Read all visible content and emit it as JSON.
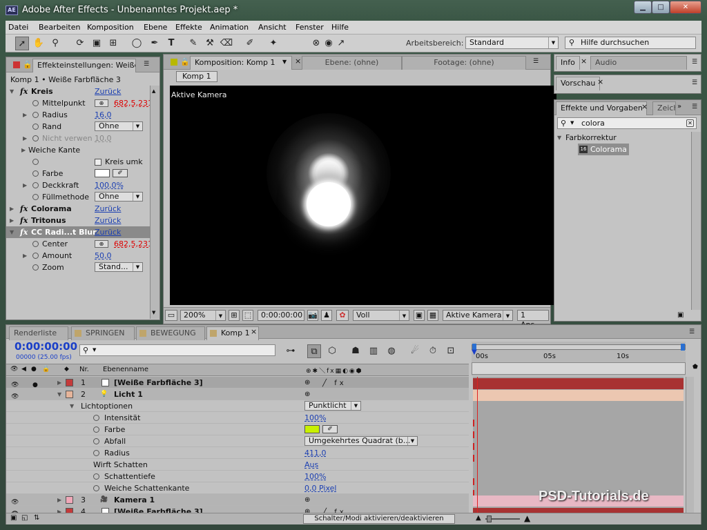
{
  "window": {
    "title": "Adobe After Effects - Unbenanntes Projekt.aep *",
    "app_badge": "AE"
  },
  "menu": [
    "Datei",
    "Bearbeiten",
    "Komposition",
    "Ebene",
    "Effekte",
    "Animation",
    "Ansicht",
    "Fenster",
    "Hilfe"
  ],
  "toolbar": {
    "workspace_label": "Arbeitsbereich:",
    "workspace_value": "Standard",
    "help_placeholder": "Hilfe durchsuchen"
  },
  "effects_panel": {
    "tab": "Effekteinstellungen: Weiße",
    "breadcrumb": "Komp 1 • Weiße Farbfläche 3",
    "rows": [
      {
        "type": "fx",
        "name": "Kreis",
        "reset": "Zurück"
      },
      {
        "type": "prop",
        "name": "Mittelpunkt",
        "value": "682,5,231",
        "color": "red",
        "crosshair": true
      },
      {
        "type": "prop",
        "name": "Radius",
        "value": "16,0",
        "color": "blue",
        "twirl": true
      },
      {
        "type": "prop",
        "name": "Rand",
        "dropdown": "Ohne"
      },
      {
        "type": "prop",
        "name": "Nicht verwen",
        "value": "10,0",
        "color": "gray",
        "twirl": true,
        "disabled": true
      },
      {
        "type": "group",
        "name": "Weiche Kante"
      },
      {
        "type": "prop",
        "name": "",
        "checkbox": "Kreis umk"
      },
      {
        "type": "prop",
        "name": "Farbe",
        "swatch": "#ffffff"
      },
      {
        "type": "prop",
        "name": "Deckkraft",
        "value": "100,0%",
        "color": "blue",
        "twirl": true
      },
      {
        "type": "prop",
        "name": "Füllmethode",
        "dropdown": "Ohne"
      },
      {
        "type": "fx",
        "name": "Colorama",
        "reset": "Zurück",
        "collapsed": true
      },
      {
        "type": "fx",
        "name": "Tritonus",
        "reset": "Zurück",
        "collapsed": true
      },
      {
        "type": "fx",
        "name": "CC Radi...t Blur",
        "reset": "Zurück",
        "selected": true
      },
      {
        "type": "prop",
        "name": "Center",
        "value": "682,5,231",
        "color": "red",
        "crosshair": true
      },
      {
        "type": "prop",
        "name": "Amount",
        "value": "50,0",
        "color": "blue",
        "twirl": true
      },
      {
        "type": "prop",
        "name": "Zoom",
        "dropdown": "Stand..."
      }
    ]
  },
  "comp_panel": {
    "tabs": [
      "Komposition: Komp 1",
      "Ebene: (ohne)",
      "Footage: (ohne)"
    ],
    "sub_tab": "Komp 1",
    "camera_label": "Aktive Kamera",
    "footer": {
      "zoom": "200%",
      "timecode": "0:00:00:00",
      "resolution": "Voll",
      "camera": "Aktive Kamera",
      "views": "1 Ans..."
    }
  },
  "info_panel": {
    "tabs": [
      "Info",
      "Audio"
    ]
  },
  "preview_panel": {
    "tab": "Vorschau"
  },
  "effects_presets": {
    "tabs": [
      "Effekte und Vorgaben",
      "Zeich"
    ],
    "search_value": "colora",
    "category": "Farbkorrektur",
    "item": "Colorama",
    "item_badge": "16"
  },
  "timeline": {
    "tabs": [
      "Renderliste",
      "SPRINGEN",
      "BEWEGUNG",
      "Komp 1"
    ],
    "timecode": "0:00:00:00",
    "fps": "00000 (25.00 fps)",
    "search_placeholder": "",
    "col_nr": "Nr.",
    "col_name": "Ebenenname",
    "ruler": [
      "00s",
      "05s",
      "10s"
    ],
    "rows": [
      {
        "kind": "layer",
        "nr": "1",
        "name": "[Weiße Farbfläche 3]",
        "chip": "#c43a3a",
        "icon": "solid",
        "selected": true
      },
      {
        "kind": "layer",
        "nr": "2",
        "name": "Licht 1",
        "chip": "#e6b49a",
        "icon": "light",
        "open": true
      },
      {
        "kind": "group",
        "name": "Lichtoptionen",
        "dropdown": "Punktlicht"
      },
      {
        "kind": "prop",
        "name": "Intensität",
        "value": "100%"
      },
      {
        "kind": "prop",
        "name": "Farbe",
        "swatch": "#c8f000"
      },
      {
        "kind": "prop",
        "name": "Abfall",
        "dropdown": "Umgekehrtes Quadrat (b..."
      },
      {
        "kind": "prop",
        "name": "Radius",
        "value": "411,0"
      },
      {
        "kind": "prop2",
        "name": "Wirft Schatten",
        "value": "Aus"
      },
      {
        "kind": "prop",
        "name": "Schattentiefe",
        "value": "100%"
      },
      {
        "kind": "prop",
        "name": "Weiche Schattenkante",
        "value": "0,0 Pixel"
      },
      {
        "kind": "layer",
        "nr": "3",
        "name": "Kamera 1",
        "chip": "#f0a8b8",
        "icon": "camera"
      },
      {
        "kind": "layer",
        "nr": "4",
        "name": "[Weiße Farbfläche 3]",
        "chip": "#c43a3a",
        "icon": "solid",
        "partial": true
      }
    ],
    "footer_toggle": "Schalter/Modi aktivieren/deaktivieren"
  },
  "watermark": "PSD-Tutorials.de"
}
